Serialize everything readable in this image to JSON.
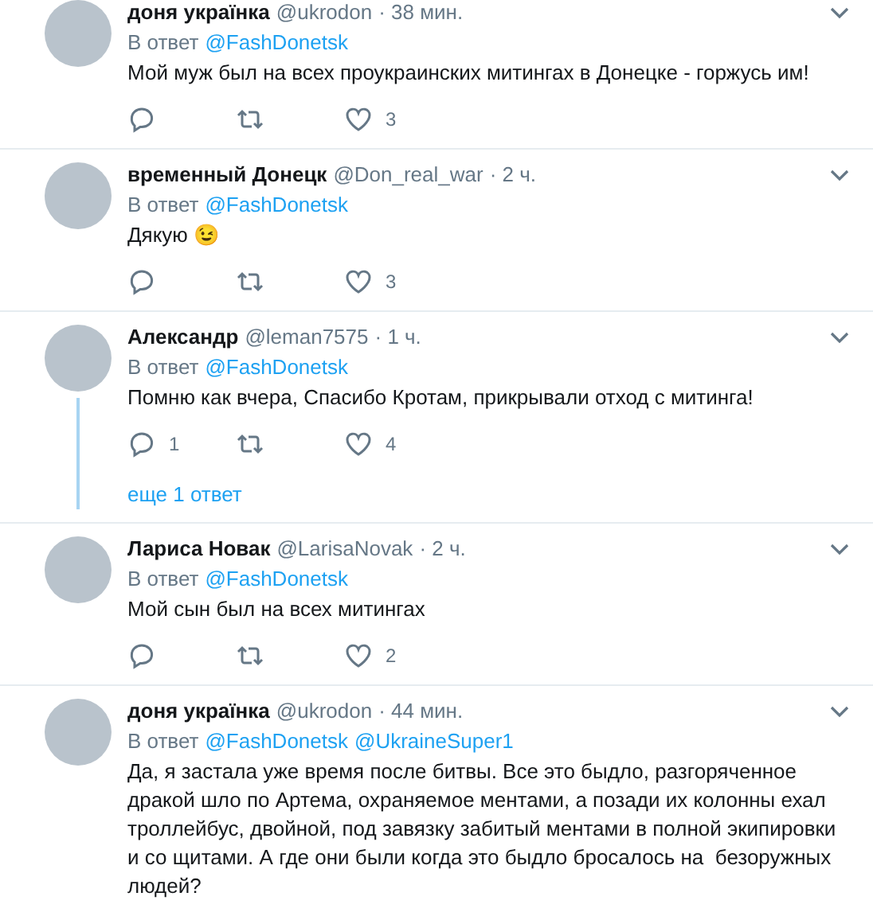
{
  "tweets": [
    {
      "name": "доня українка",
      "handle": "@ukrodon",
      "time": "· 38 мин.",
      "reply_label": "В ответ",
      "mentions": [
        "@FashDonetsk"
      ],
      "text": "Мой муж был на всех проукраинских митингах в Донецке - горжусь им!",
      "likes": "3"
    },
    {
      "name": "временный Донецк",
      "handle": "@Don_real_war",
      "time": "· 2 ч.",
      "reply_label": "В ответ",
      "mentions": [
        "@FashDonetsk"
      ],
      "text": "Дякую 😉",
      "likes": "3"
    },
    {
      "name": "Александр",
      "handle": "@leman7575",
      "time": "· 1 ч.",
      "reply_label": "В ответ",
      "mentions": [
        "@FashDonetsk"
      ],
      "text": "Помню как вчера, Спасибо Кротам, прикрывали отход с митинга!",
      "replies": "1",
      "likes": "4",
      "more_replies": "еще 1 ответ"
    },
    {
      "name": "Лариса Новак",
      "handle": "@LarisaNovak",
      "time": "· 2 ч.",
      "reply_label": "В ответ",
      "mentions": [
        "@FashDonetsk"
      ],
      "text": "Мой сын был на всех митингах",
      "likes": "2"
    },
    {
      "name": "доня українка",
      "handle": "@ukrodon",
      "time": "· 44 мин.",
      "reply_label": "В ответ",
      "mentions": [
        "@FashDonetsk",
        "@UkraineSuper1"
      ],
      "text": "Да, я застала уже время после битвы. Все это быдло, разгоряченное дракой шло по Артема, охраняемое ментами, а позади их колонны ехал троллейбус, двойной, под завязку забитый ментами в полной экипировки и со щитами. А где они были когда это быдло бросалось на  безоружных людей?"
    }
  ]
}
